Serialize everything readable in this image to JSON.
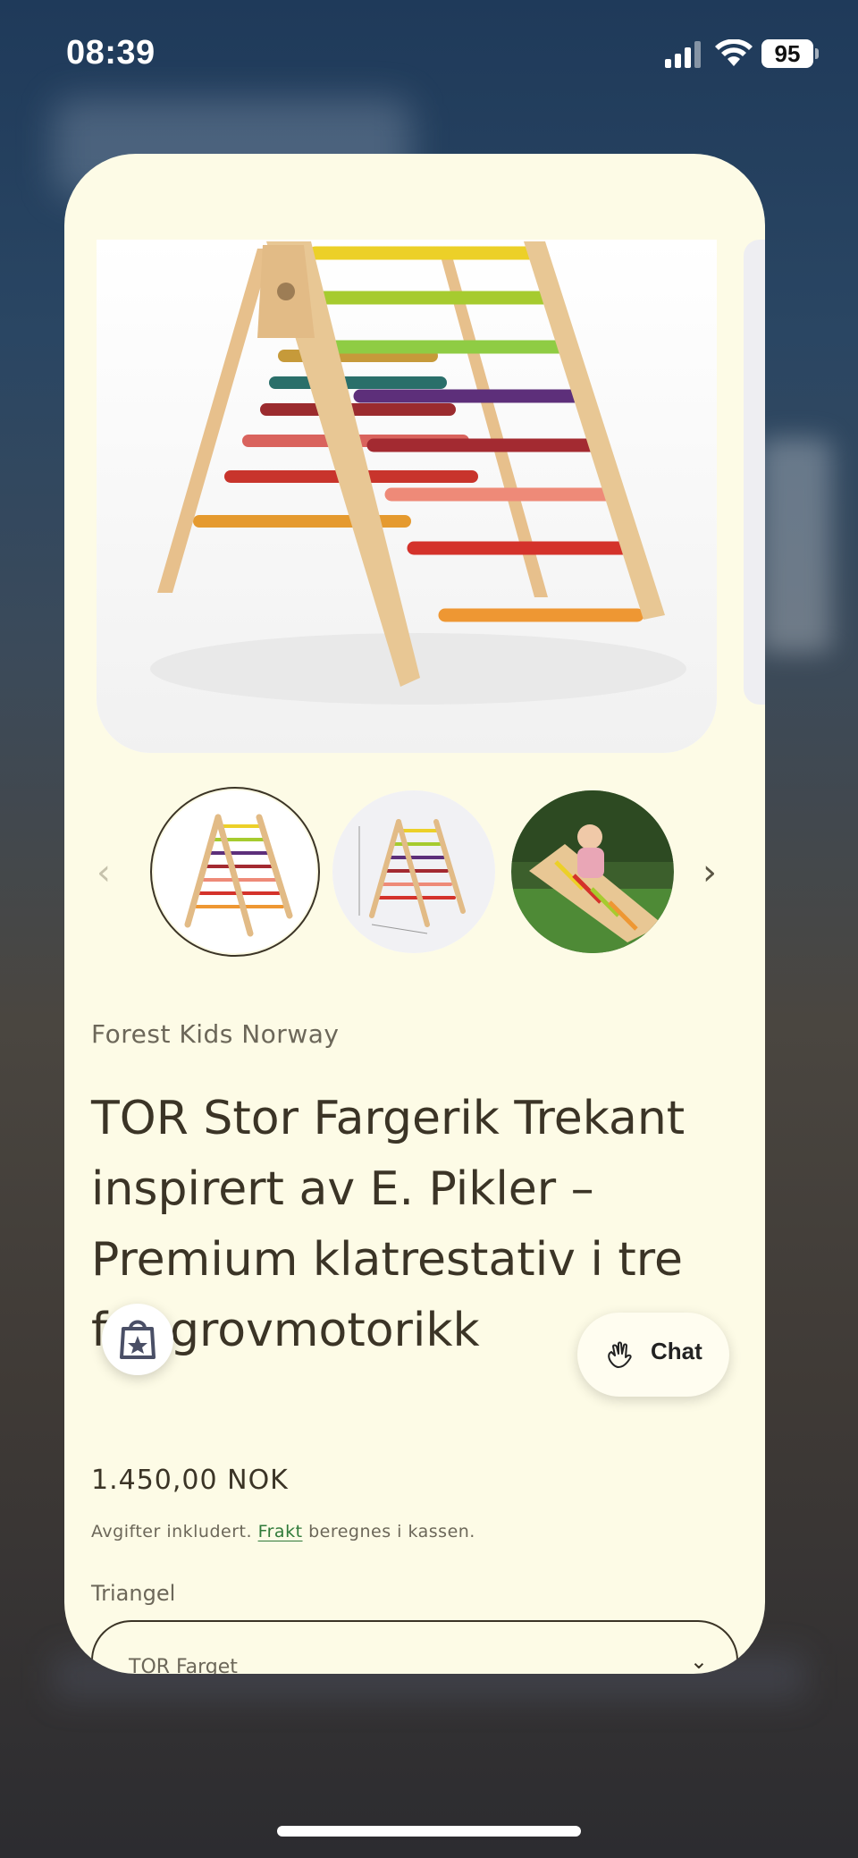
{
  "status_bar": {
    "time": "08:39",
    "battery": "95"
  },
  "gallery": {
    "prev_label": "‹",
    "next_label": "›"
  },
  "product": {
    "brand": "Forest Kids Norway",
    "title": "TOR Stor Fargerik Trekant inspirert av E. Pikler – Premium klatrestativ i tre for grovmotorikk",
    "price": "1.450,00 NOK",
    "tax_before": "Avgifter inkludert. ",
    "tax_link": "Frakt",
    "tax_after": " beregnes i kassen.",
    "variant_label": "Triangel",
    "variant_value": "TOR Farget"
  },
  "chat": {
    "label": "Chat"
  },
  "colors": {
    "card_bg": "#fdfbe6",
    "text": "#3b3426",
    "link": "#2f7a39"
  }
}
